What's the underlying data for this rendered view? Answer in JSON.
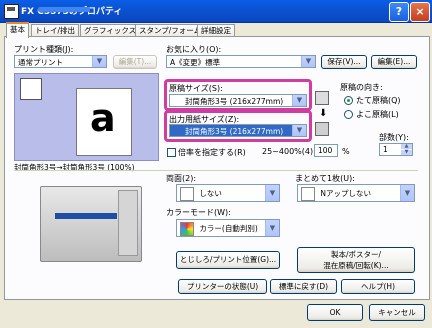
{
  "window": {
    "title": "FX C5575のプロパティ",
    "help": "?",
    "close": "×"
  },
  "tabs": [
    "基本",
    "トレイ/排出",
    "グラフィックス",
    "スタンプ/フォーム",
    "詳細設定"
  ],
  "print_type": {
    "label": "プリント種類(J):",
    "value": "通常プリント",
    "edit_button": "編集(T)..."
  },
  "favorites": {
    "label": "お気に入り(O):",
    "value": "A《変更》標準",
    "save_button": "保存(V)...",
    "edit_button": "編集(E)..."
  },
  "paper_size": {
    "label": "原稿サイズ(S):",
    "value": "封筒角形3号 (216x277mm)"
  },
  "output_size": {
    "label": "出力用紙サイズ(Z):",
    "value": "封筒角形3号 (216x277mm)"
  },
  "orientation": {
    "label": "原稿の向き:",
    "portrait": "たて原稿(Q)",
    "landscape": "よこ原稿(L)",
    "selected": "portrait"
  },
  "copies": {
    "label": "部数(Y):",
    "value": "1"
  },
  "scale": {
    "checkbox": "倍率を指定する(R)",
    "range": "25~400%(4):",
    "value": "100",
    "unit": "%"
  },
  "preview_caption": "封筒角形3号→封筒角形3号 (100%)",
  "preview_letter": "a",
  "duplex": {
    "label": "両面(2):",
    "value": "しない"
  },
  "nup": {
    "label": "まとめて1枚(U):",
    "value": "Nアップしない"
  },
  "color_mode": {
    "label": "カラーモード(W):",
    "value": "カラー(自動判別)"
  },
  "buttons": {
    "binding": "とじしろ/プリント位置(G)...",
    "booklet": "製本/ポスター/\n混在原稿/回転(K)...",
    "printer_status": "プリンターの状態(U)",
    "defaults": "標準に戻す(D)",
    "help": "ヘルプ(H)",
    "ok": "OK",
    "cancel": "キャンセル"
  }
}
